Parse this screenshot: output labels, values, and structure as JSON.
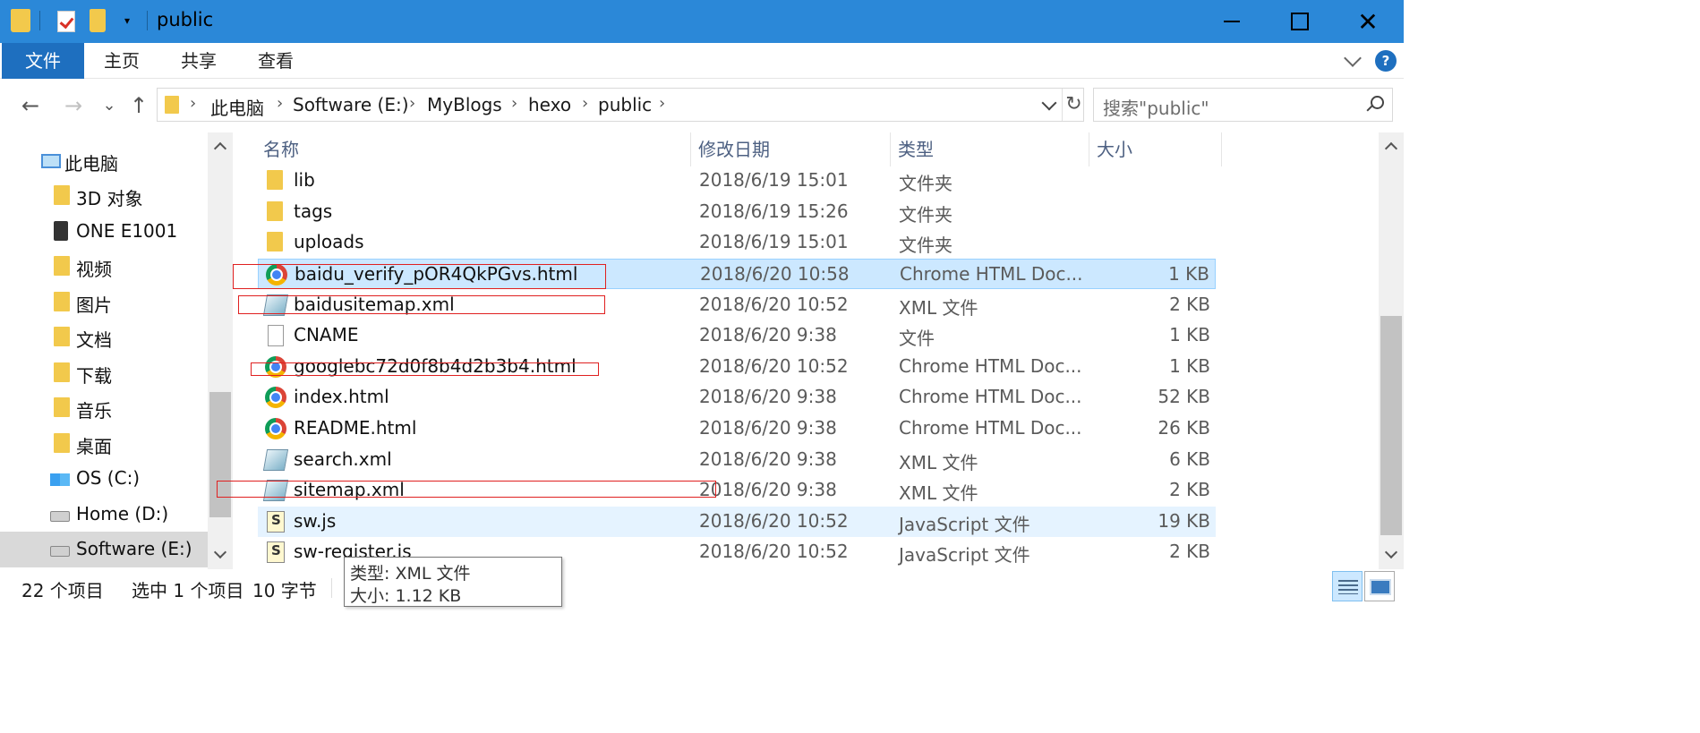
{
  "window": {
    "title": "public",
    "minimize_label": "",
    "maximize_label": "",
    "close_label": "✕"
  },
  "ribbon": {
    "file_tab": "文件",
    "tabs": [
      "主页",
      "共享",
      "查看"
    ],
    "help_label": "?"
  },
  "navigation": {
    "back": "←",
    "forward": "→",
    "recent": "⌄",
    "up": "↑",
    "breadcrumbs": [
      "此电脑",
      "Software (E:)",
      "MyBlogs",
      "hexo",
      "public"
    ],
    "refresh": "↻",
    "search_placeholder": "搜索\"public\""
  },
  "sidebar": {
    "items": [
      {
        "label": "此电脑",
        "icon": "computer-icon"
      },
      {
        "label": "3D 对象",
        "icon": "3d-objects-folder-icon"
      },
      {
        "label": "ONE E1001",
        "icon": "phone-device-icon"
      },
      {
        "label": "视频",
        "icon": "videos-folder-icon"
      },
      {
        "label": "图片",
        "icon": "pictures-folder-icon"
      },
      {
        "label": "文档",
        "icon": "documents-folder-icon"
      },
      {
        "label": "下载",
        "icon": "downloads-folder-icon"
      },
      {
        "label": "音乐",
        "icon": "music-folder-icon"
      },
      {
        "label": "桌面",
        "icon": "desktop-folder-icon"
      },
      {
        "label": "OS (C:)",
        "icon": "windows-drive-icon"
      },
      {
        "label": "Home (D:)",
        "icon": "drive-icon"
      },
      {
        "label": "Software (E:)",
        "icon": "drive-icon",
        "selected": true
      }
    ]
  },
  "filelist": {
    "columns": {
      "name": "名称",
      "modified": "修改日期",
      "type": "类型",
      "size": "大小"
    },
    "sort_indicator": "^",
    "rows": [
      {
        "name": "lib",
        "modified": "2018/6/19 15:01",
        "type": "文件夹",
        "size": "",
        "icon": "folder-icon"
      },
      {
        "name": "tags",
        "modified": "2018/6/19 15:26",
        "type": "文件夹",
        "size": "",
        "icon": "folder-icon"
      },
      {
        "name": "uploads",
        "modified": "2018/6/19 15:01",
        "type": "文件夹",
        "size": "",
        "icon": "folder-icon"
      },
      {
        "name": "baidu_verify_pOR4QkPGvs.html",
        "modified": "2018/6/20 10:58",
        "type": "Chrome HTML Doc...",
        "size": "1 KB",
        "icon": "chrome-icon",
        "state": "selected"
      },
      {
        "name": "baidusitemap.xml",
        "modified": "2018/6/20 10:52",
        "type": "XML 文件",
        "size": "2 KB",
        "icon": "xml-file-icon"
      },
      {
        "name": "CNAME",
        "modified": "2018/6/20 9:38",
        "type": "文件",
        "size": "1 KB",
        "icon": "blank-file-icon"
      },
      {
        "name": "googlebc72d0f8b4d2b3b4.html",
        "modified": "2018/6/20 10:52",
        "type": "Chrome HTML Doc...",
        "size": "1 KB",
        "icon": "chrome-icon"
      },
      {
        "name": "index.html",
        "modified": "2018/6/20 9:38",
        "type": "Chrome HTML Doc...",
        "size": "52 KB",
        "icon": "chrome-icon"
      },
      {
        "name": "README.html",
        "modified": "2018/6/20 9:38",
        "type": "Chrome HTML Doc...",
        "size": "26 KB",
        "icon": "chrome-icon"
      },
      {
        "name": "search.xml",
        "modified": "2018/6/20 9:38",
        "type": "XML 文件",
        "size": "6 KB",
        "icon": "xml-file-icon"
      },
      {
        "name": "sitemap.xml",
        "modified": "2018/6/20 9:38",
        "type": "XML 文件",
        "size": "2 KB",
        "icon": "xml-file-icon"
      },
      {
        "name": "sw.js",
        "modified": "2018/6/20 10:52",
        "type": "JavaScript 文件",
        "size": "19 KB",
        "icon": "js-file-icon",
        "state": "hover"
      },
      {
        "name": "sw-register.js",
        "modified": "2018/6/20 10:52",
        "type": "JavaScript 文件",
        "size": "2 KB",
        "icon": "js-file-icon"
      }
    ]
  },
  "statusbar": {
    "item_count": "22 个项目",
    "selection": "选中 1 个项目",
    "selection_size": "10 字节"
  },
  "tooltip": {
    "type_line": "类型: XML 文件",
    "size_line": "大小: 1.12 KB"
  },
  "colors": {
    "titlebar": "#2b88d8",
    "file_tab": "#1e6fbf",
    "selection": "#cce8ff",
    "annotation_box": "#e02020"
  }
}
